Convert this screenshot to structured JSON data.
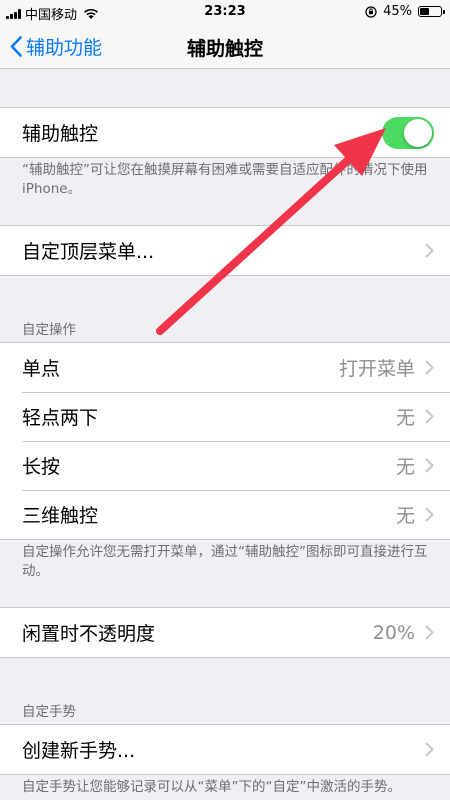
{
  "status_bar": {
    "carrier": "中国移动",
    "time": "23:23",
    "battery": "45%",
    "battery_level": 0.45
  },
  "nav": {
    "back_label": "辅助功能",
    "title": "辅助触控"
  },
  "toggle_group": {
    "label": "辅助触控",
    "enabled": true,
    "accent_color": "#4cd964",
    "note": "“辅助触控”可让您在触摸屏幕有困难或需要自适应配件的情况下使用 iPhone。"
  },
  "customize_menu": {
    "label": "自定顶层菜单..."
  },
  "custom_actions": {
    "header": "自定操作",
    "rows": [
      {
        "label": "单点",
        "value": "打开菜单"
      },
      {
        "label": "轻点两下",
        "value": "无"
      },
      {
        "label": "长按",
        "value": "无"
      },
      {
        "label": "三维触控",
        "value": "无"
      }
    ],
    "note": "自定操作允许您无需打开菜单，通过“辅助触控”图标即可直接进行互动。"
  },
  "idle_opacity": {
    "label": "闲置时不透明度",
    "value": "20%"
  },
  "custom_gestures": {
    "header": "自定手势",
    "create_label": "创建新手势...",
    "note": "自定手势让您能够记录可以从“菜单”下的“自定”中激活的手势。"
  },
  "annotation": {
    "arrow_color": "#f0354a"
  },
  "colors": {
    "link": "#0a7aff",
    "background": "#efeff4",
    "secondary_text": "#8e8e93"
  }
}
